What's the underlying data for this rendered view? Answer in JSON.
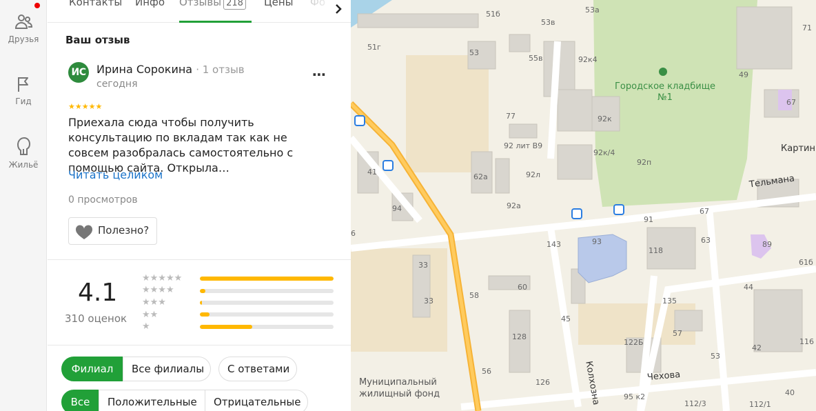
{
  "rail": {
    "items": [
      {
        "label": "Друзья",
        "icon": "friends-icon"
      },
      {
        "label": "Гид",
        "icon": "flag-icon"
      },
      {
        "label": "Жильё",
        "icon": "house-icon"
      }
    ],
    "notification_color": "#e00000"
  },
  "tabs": {
    "items": [
      {
        "label": "Контакты"
      },
      {
        "label": "Инфо"
      },
      {
        "label": "Отзывы",
        "count": "218"
      },
      {
        "label": "Цены"
      },
      {
        "label": "Фо"
      }
    ],
    "active": "Отзывы",
    "accent_color": "#21a038"
  },
  "review": {
    "heading": "Ваш отзыв",
    "avatar_initials": "ИС",
    "author": "Ирина Сорокина",
    "author_meta": "1 отзыв",
    "date": "сегодня",
    "stars": "★★★★★",
    "text": "Приехала сюда чтобы получить консультацию по вкладам так как не совсем разобралась самостоятельно с помощью сайта. Открыла…",
    "read_more": "Читать целиком",
    "views": "0 просмотров",
    "useful_label": "Полезно?"
  },
  "rating": {
    "value": "4.1",
    "count": "310 оценок",
    "rows": [
      {
        "stars": "★★★★★",
        "fraction": 1.0
      },
      {
        "stars": "★★★★",
        "fraction": 0.04
      },
      {
        "stars": "★★★",
        "fraction": 0.015
      },
      {
        "stars": "★★",
        "fraction": 0.07
      },
      {
        "stars": "★",
        "fraction": 0.39
      }
    ]
  },
  "filters": {
    "row1": [
      "Филиал",
      "Все филиалы",
      "С ответами"
    ],
    "row2": [
      "Все",
      "Положительные",
      "Отрицательные"
    ]
  },
  "map": {
    "labels": {
      "cemetery": "Городское кладбище\n№1",
      "street_telmana": "Тельмана",
      "street_chekhova": "Чехова",
      "street_kolkhoznaya": "Колхозна",
      "street_kartin": "Картин",
      "municipal": "Муниципальный\nжилищный фонд"
    },
    "houses": [
      "51б",
      "53а",
      "53в",
      "71",
      "51г",
      "53",
      "55в",
      "92к4",
      "49",
      "67",
      "77",
      "92 лит В9",
      "92к",
      "92к/4",
      "41",
      "62а",
      "92л",
      "92п",
      "94",
      "92а",
      "91",
      "67",
      "143",
      "93",
      "118",
      "63",
      "89",
      "6",
      "33",
      "33",
      "60",
      "58",
      "45",
      "135",
      "61б",
      "44",
      "57",
      "128",
      "122Б",
      "42",
      "116",
      "56",
      "126",
      "53",
      "95 к2",
      "112/3",
      "112/1",
      "40"
    ]
  }
}
